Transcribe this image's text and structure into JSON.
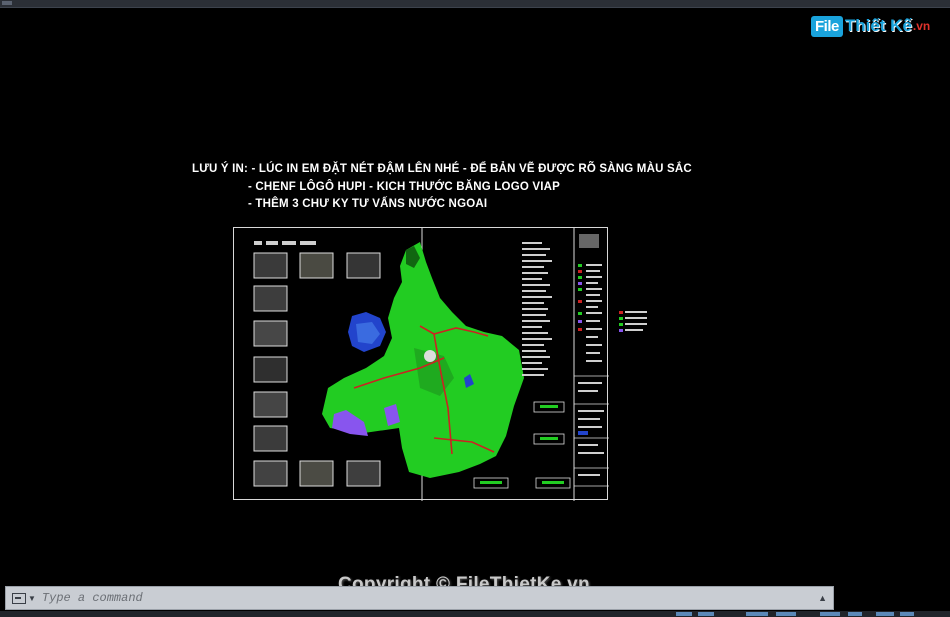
{
  "watermark_logo": {
    "box_text": "File",
    "rest_text": "Thiết Kế",
    "domain_text": ".vn"
  },
  "notes": {
    "line1": "LƯU Ý IN: - LÚC IN EM ĐẶT NÉT ĐẬM LÊN NHÉ - ĐỂ BẢN VẼ ĐƯỢC RÕ SÀNG MÀU SẮC",
    "line2": "- CHENF LÔGÔ HUPI - KICH THƯỚC BĂNG LOGO VIAP",
    "line3": "- THÊM 3 CHƯ KY TƯ VẤNS NƯỚC NGOAI"
  },
  "copyright": "Copyright © FileThietKe.vn",
  "command_line": {
    "placeholder": "Type a command",
    "value": ""
  },
  "colors": {
    "canvas": "#000000",
    "map_green": "#22cc22",
    "map_blue": "#2244cc",
    "map_purple": "#8855ee",
    "boundary_red": "#cc2222",
    "logo_blue": "#1aa3dc",
    "logo_red": "#e0322b"
  }
}
